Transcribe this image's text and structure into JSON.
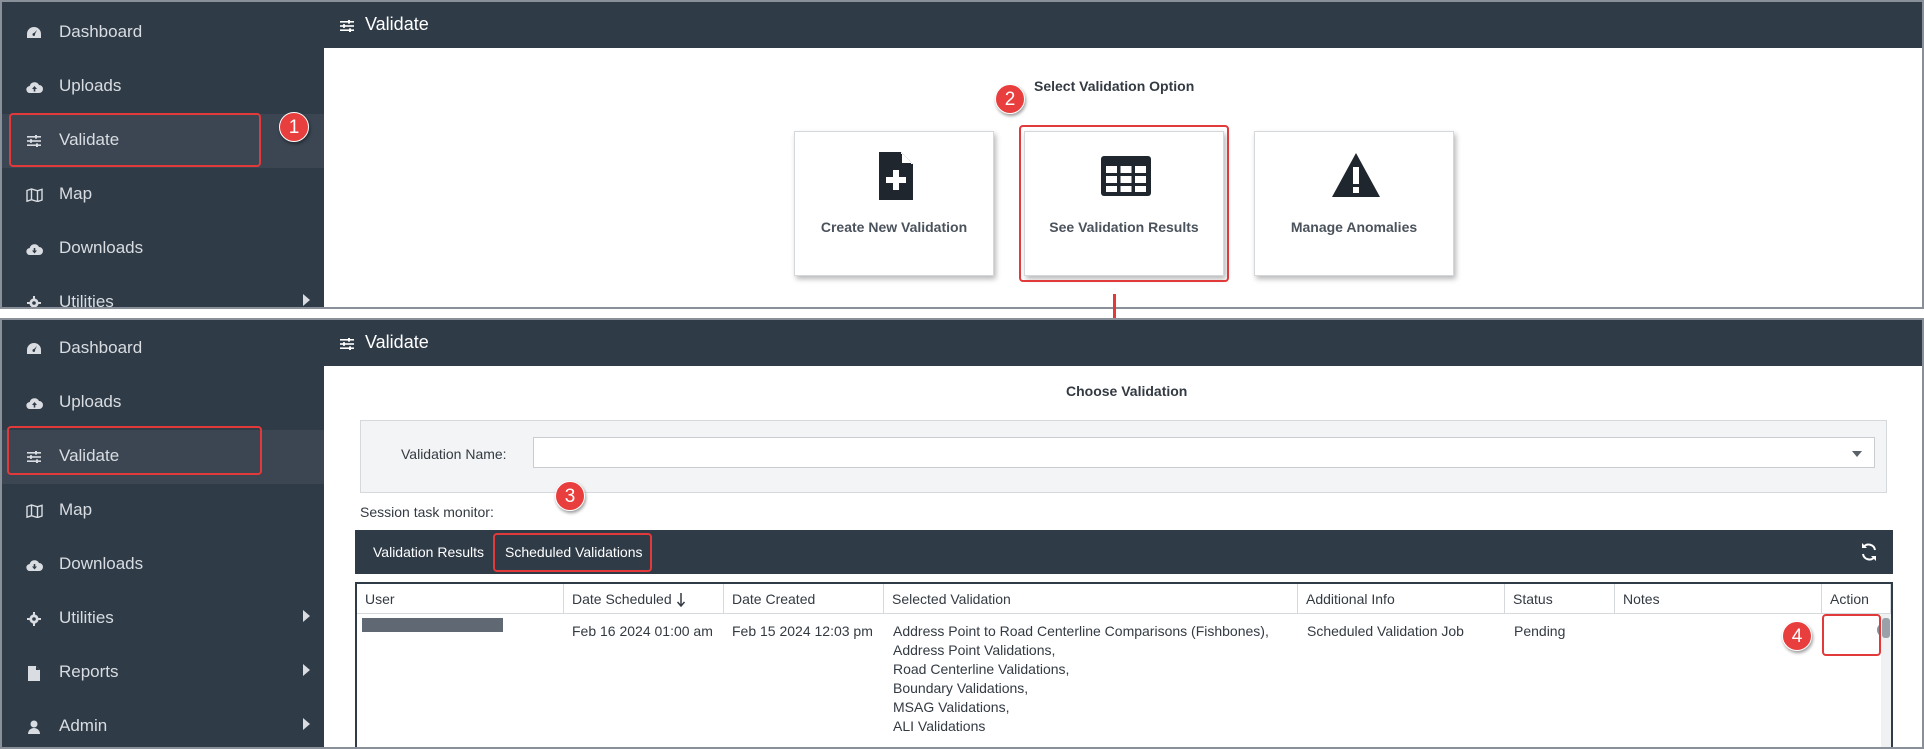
{
  "sidebar_top": {
    "items": [
      {
        "label": "Dashboard",
        "icon": "dashboard-icon"
      },
      {
        "label": "Uploads",
        "icon": "cloud-upload-icon"
      },
      {
        "label": "Validate",
        "icon": "sliders-icon",
        "active": true
      },
      {
        "label": "Map",
        "icon": "map-icon"
      },
      {
        "label": "Downloads",
        "icon": "cloud-download-icon"
      },
      {
        "label": "Utilities",
        "icon": "gear-icon",
        "has_submenu": true
      }
    ]
  },
  "sidebar_bottom": {
    "items": [
      {
        "label": "Dashboard",
        "icon": "dashboard-icon"
      },
      {
        "label": "Uploads",
        "icon": "cloud-upload-icon"
      },
      {
        "label": "Validate",
        "icon": "sliders-icon",
        "active": true
      },
      {
        "label": "Map",
        "icon": "map-icon"
      },
      {
        "label": "Downloads",
        "icon": "cloud-download-icon"
      },
      {
        "label": "Utilities",
        "icon": "gear-icon",
        "has_submenu": true
      },
      {
        "label": "Reports",
        "icon": "file-icon",
        "has_submenu": true
      },
      {
        "label": "Admin",
        "icon": "user-icon",
        "has_submenu": true
      }
    ]
  },
  "header": {
    "title": "Validate",
    "icon": "sliders-icon"
  },
  "options": {
    "heading": "Select Validation Option",
    "cards": [
      {
        "label": "Create New Validation",
        "icon": "file-plus-icon"
      },
      {
        "label": "See Validation Results",
        "icon": "table-icon"
      },
      {
        "label": "Manage Anomalies",
        "icon": "warning-icon"
      }
    ]
  },
  "choose": {
    "heading": "Choose Validation",
    "validation_name_label": "Validation Name:",
    "validation_name_value": "",
    "session_label": "Session task monitor:"
  },
  "tabs": {
    "items": [
      "Validation Results",
      "Scheduled Validations"
    ],
    "active": "Scheduled Validations",
    "refresh_icon": "refresh-icon"
  },
  "table": {
    "columns": [
      "User",
      "Date Scheduled",
      "Date Created",
      "Selected Validation",
      "Additional Info",
      "Status",
      "Notes",
      "Action"
    ],
    "sort_column": "Date Scheduled",
    "sort_direction": "descending",
    "rows": [
      {
        "user": "",
        "date_scheduled": "Feb 16 2024 01:00 am",
        "date_created": "Feb 15 2024 12:03 pm",
        "selected_validation": [
          "Address Point to Road Centerline Comparisons (Fishbones),",
          "Address Point Validations,",
          "Road Centerline Validations,",
          "Boundary Validations,",
          "MSAG Validations,",
          "ALI Validations"
        ],
        "additional_info": "Scheduled Validation Job",
        "status": "Pending",
        "notes": "",
        "action_icon": "cancel-circle-icon"
      }
    ]
  },
  "annotations": {
    "badges": [
      "1",
      "2",
      "3",
      "4"
    ],
    "color": "#e23a3a"
  },
  "colors": {
    "sidebar": "#2f3b47",
    "sidebar_active": "#3b4652",
    "header": "#2f3b47",
    "callout": "#e23a3a"
  }
}
